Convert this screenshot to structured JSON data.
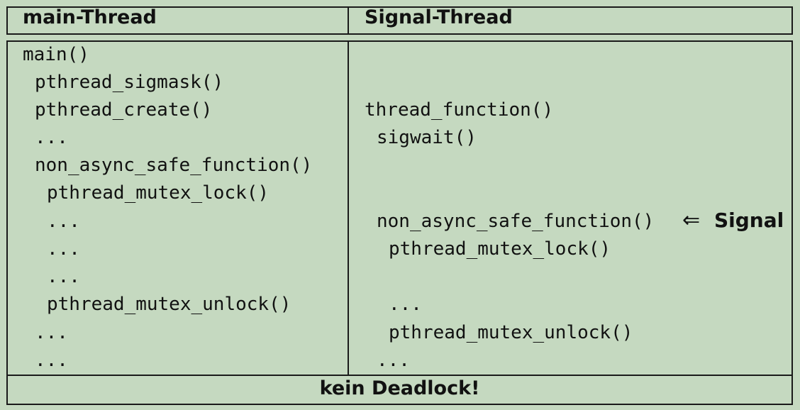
{
  "headers": {
    "left": "main-Thread",
    "right": "Signal-Thread"
  },
  "left_lines": [
    "main()",
    "pthread_sigmask()",
    "pthread_create()",
    "...",
    "non_async_safe_function()",
    "pthread_mutex_lock()",
    "...",
    "...",
    "...",
    "pthread_mutex_unlock()",
    "...",
    "..."
  ],
  "right_lines": [
    "thread_function()",
    "sigwait()",
    "non_async_safe_function()",
    "pthread_mutex_lock()",
    "...",
    "pthread_mutex_unlock()",
    "..."
  ],
  "arrow_symbol": "⇐",
  "signal_label": "Signal",
  "footer": "kein Deadlock!"
}
